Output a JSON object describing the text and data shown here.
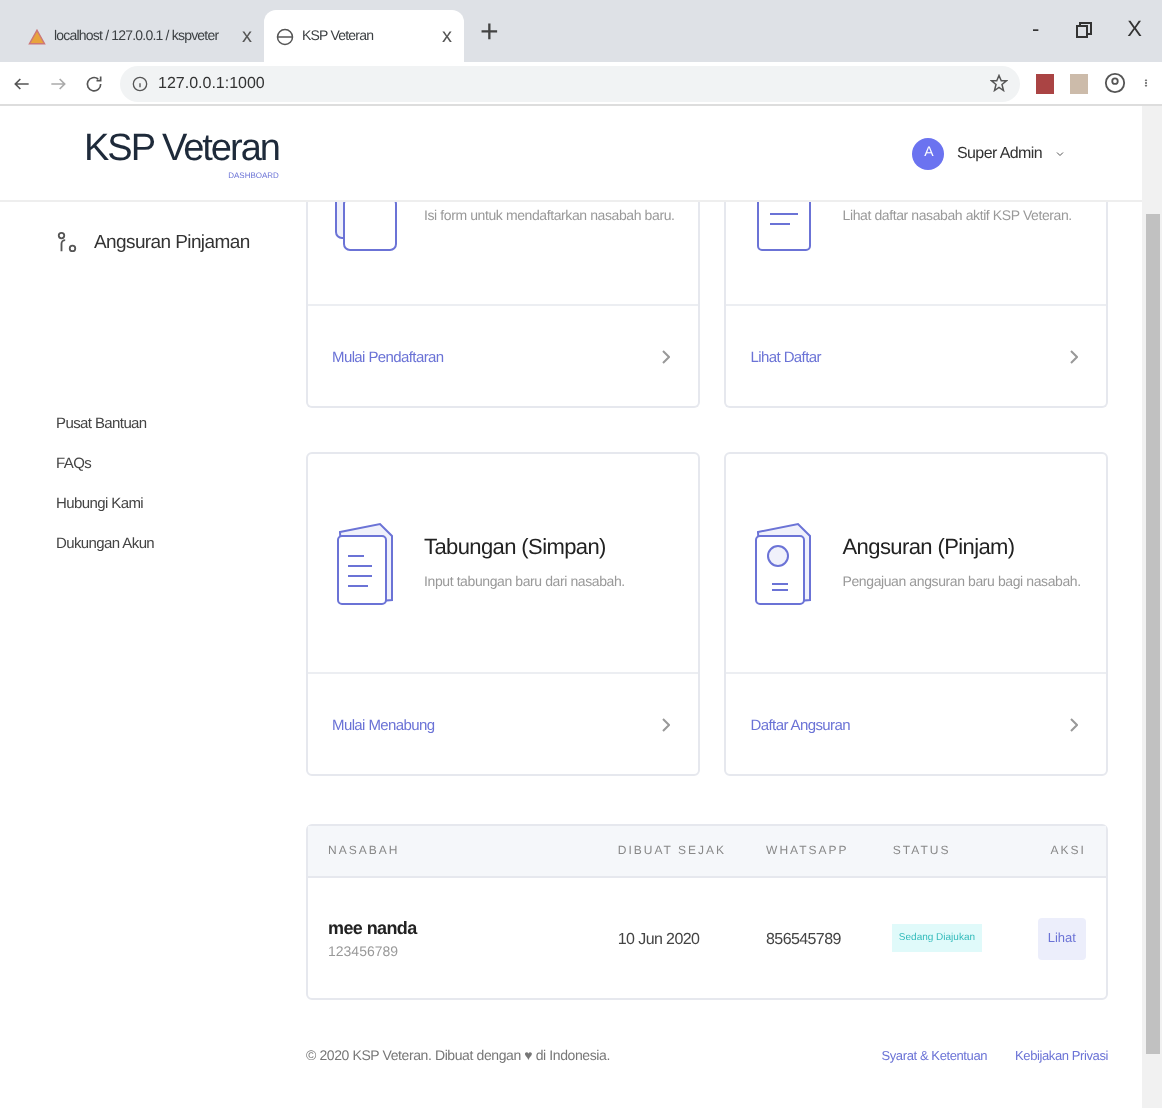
{
  "browser": {
    "tabs": [
      {
        "title": "localhost / 127.0.0.1 / kspveter",
        "selected": false,
        "close": "x"
      },
      {
        "title": "KSP Veteran",
        "selected": true,
        "close": "x"
      }
    ],
    "new_tab": "+",
    "controls": [
      "-",
      "X"
    ],
    "address": "127.0.0.1:1000"
  },
  "header": {
    "brand": "KSP Veteran",
    "brand_sub": "DASHBOARD",
    "avatar": "A",
    "user": "Super Admin"
  },
  "sidebar": {
    "items": [
      {
        "label": "Angsuran Pinjaman"
      }
    ],
    "help_links": [
      "Pusat Bantuan",
      "FAQs",
      "Hubungi Kami",
      "Dukungan Akun"
    ]
  },
  "cards": [
    {
      "kind": "cut",
      "description": "Isi form untuk mendaftarkan nasabah baru.",
      "link": "Mulai Pendaftaran"
    },
    {
      "kind": "cut",
      "description": "Lihat daftar nasabah aktif KSP Veteran.",
      "link": "Lihat Daftar"
    },
    {
      "kind": "full",
      "title": "Tabungan (Simpan)",
      "description": "Input tabungan baru dari nasabah.",
      "link": "Mulai Menabung"
    },
    {
      "kind": "full",
      "title": "Angsuran (Pinjam)",
      "description": "Pengajuan angsuran baru bagi nasabah.",
      "link": "Daftar Angsuran"
    }
  ],
  "table": {
    "columns": [
      "NASABAH",
      "DIBUAT SEJAK",
      "WHATSAPP",
      "STATUS",
      "AKSI"
    ],
    "rows": [
      {
        "name": "mee nanda",
        "id": "123456789",
        "created": "10 Jun 2020",
        "whatsapp": "856545789",
        "status": "Sedang Diajukan",
        "action": "Lihat"
      }
    ]
  },
  "footer": {
    "copyright": "© 2020 KSP Veteran. Dibuat dengan ♥ di Indonesia.",
    "links": [
      "Syarat & Ketentuan",
      "Kebijakan Privasi"
    ]
  }
}
